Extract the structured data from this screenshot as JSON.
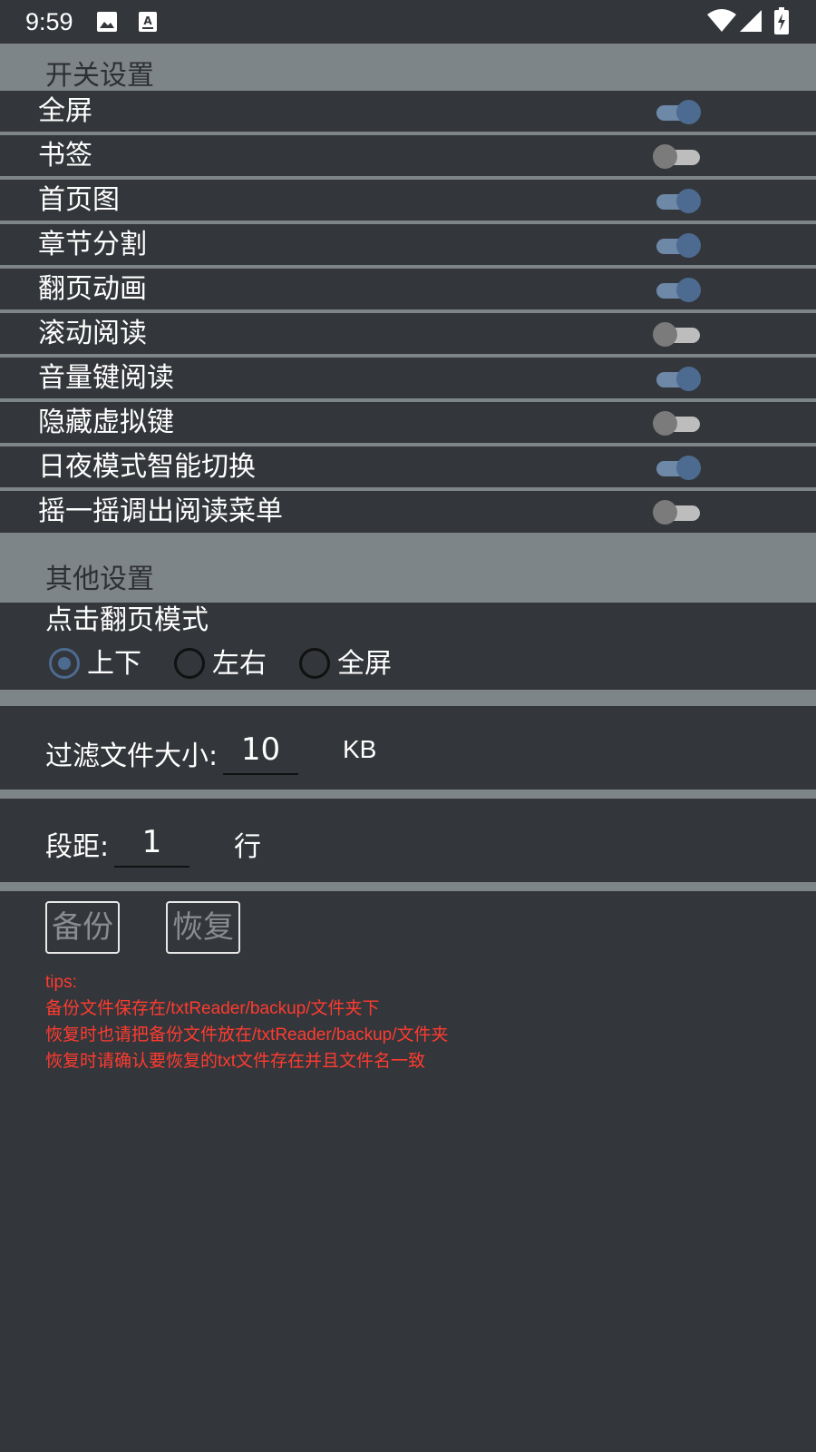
{
  "status_bar": {
    "time": "9:59",
    "icons": [
      "image-icon",
      "a-text-icon",
      "wifi-icon",
      "signal-icon",
      "battery-icon"
    ]
  },
  "switch_section": {
    "title": "开关设置",
    "items": [
      {
        "label": "全屏",
        "on": true
      },
      {
        "label": "书签",
        "on": false
      },
      {
        "label": "首页图",
        "on": true
      },
      {
        "label": "章节分割",
        "on": true
      },
      {
        "label": "翻页动画",
        "on": true
      },
      {
        "label": "滚动阅读",
        "on": false
      },
      {
        "label": "音量键阅读",
        "on": true
      },
      {
        "label": "隐藏虚拟键",
        "on": false
      },
      {
        "label": "日夜模式智能切换",
        "on": true
      },
      {
        "label": "摇一摇调出阅读菜单",
        "on": false
      }
    ]
  },
  "other_section": {
    "title": "其他设置",
    "page_mode": {
      "title": "点击翻页模式",
      "options": [
        "上下",
        "左右",
        "全屏"
      ],
      "selected": "上下"
    },
    "filter": {
      "label": "过滤文件大小:",
      "value": "10",
      "unit": "KB"
    },
    "spacing": {
      "label": "段距:",
      "value": "1",
      "unit": "行"
    },
    "backup_label": "备份",
    "restore_label": "恢复",
    "tips": [
      "tips:",
      "备份文件保存在/txtReader/backup/文件夹下",
      "恢复时也请把备份文件放在/txtReader/backup/文件夹",
      "恢复时请确认要恢复的txt文件存在并且文件名一致"
    ]
  },
  "colors": {
    "background": "#33363a",
    "header": "#7e8588",
    "accent": "#4d6b90",
    "tips": "#ff3b30"
  }
}
